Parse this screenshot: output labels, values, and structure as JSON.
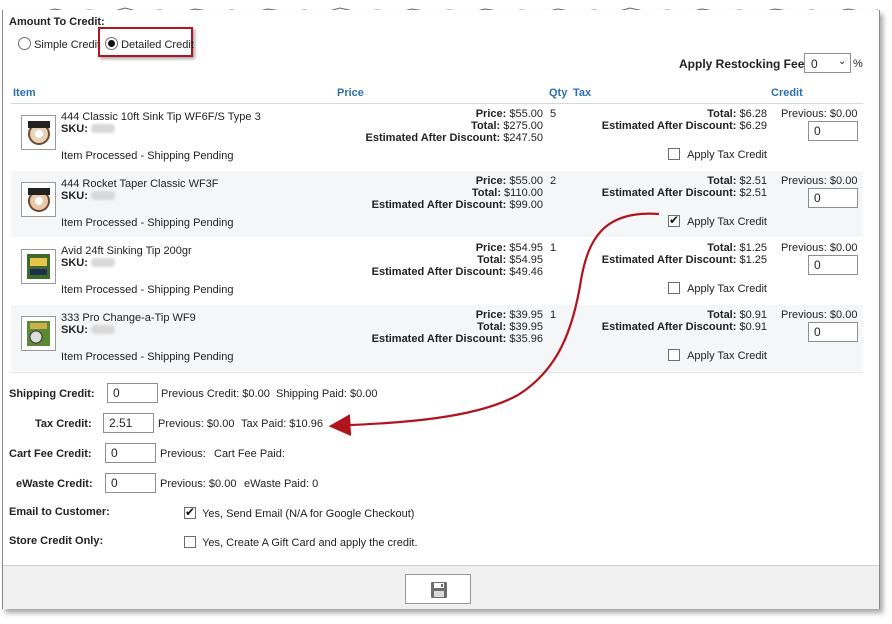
{
  "form": {
    "amount_label": "Amount To Credit:",
    "simple_credit_label": "Simple Credit",
    "detailed_credit_label": "Detailed Credit",
    "restocking_label": "Apply Restocking Fee:",
    "restocking_value": "0",
    "restocking_unit": "%"
  },
  "table": {
    "headers": {
      "item": "Item",
      "price": "Price",
      "qty": "Qty",
      "tax": "Tax",
      "credit": "Credit"
    },
    "rows": [
      {
        "name": "444 Classic 10ft Sink Tip WF6F/S Type 3",
        "sku_label": "SKU:",
        "status": "Item Processed - Shipping Pending",
        "price_label": "Price:",
        "price": "$55.00",
        "total_label": "Total:",
        "total": "$275.00",
        "est_label": "Estimated After Discount:",
        "est": "$247.50",
        "qty": "5",
        "tax_total_label": "Total:",
        "tax_total": "$6.28",
        "tax_est_label": "Estimated After Discount:",
        "tax_est": "$6.29",
        "apply_tax_label": "Apply Tax Credit",
        "apply_tax_checked": false,
        "previous": "Previous: $0.00",
        "credit": "0"
      },
      {
        "name": "444 Rocket Taper Classic WF3F",
        "sku_label": "SKU:",
        "status": "Item Processed - Shipping Pending",
        "price_label": "Price:",
        "price": "$55.00",
        "total_label": "Total:",
        "total": "$110.00",
        "est_label": "Estimated After Discount:",
        "est": "$99.00",
        "qty": "2",
        "tax_total_label": "Total:",
        "tax_total": "$2.51",
        "tax_est_label": "Estimated After Discount:",
        "tax_est": "$2.51",
        "apply_tax_label": "Apply Tax Credit",
        "apply_tax_checked": true,
        "previous": "Previous: $0.00",
        "credit": "0"
      },
      {
        "name": "Avid 24ft Sinking Tip 200gr",
        "sku_label": "SKU:",
        "status": "Item Processed - Shipping Pending",
        "price_label": "Price:",
        "price": "$54.95",
        "total_label": "Total:",
        "total": "$54.95",
        "est_label": "Estimated After Discount:",
        "est": "$49.46",
        "qty": "1",
        "tax_total_label": "Total:",
        "tax_total": "$1.25",
        "tax_est_label": "Estimated After Discount:",
        "tax_est": "$1.25",
        "apply_tax_label": "Apply Tax Credit",
        "apply_tax_checked": false,
        "previous": "Previous: $0.00",
        "credit": "0"
      },
      {
        "name": "333 Pro Change-a-Tip WF9",
        "sku_label": "SKU:",
        "status": "Item Processed - Shipping Pending",
        "price_label": "Price:",
        "price": "$39.95",
        "total_label": "Total:",
        "total": "$39.95",
        "est_label": "Estimated After Discount:",
        "est": "$35.96",
        "qty": "1",
        "tax_total_label": "Total:",
        "tax_total": "$0.91",
        "tax_est_label": "Estimated After Discount:",
        "tax_est": "$0.91",
        "apply_tax_label": "Apply Tax Credit",
        "apply_tax_checked": false,
        "previous": "Previous: $0.00",
        "credit": "0"
      }
    ]
  },
  "credits": {
    "shipping": {
      "label": "Shipping Credit:",
      "value": "0",
      "previous": "Previous Credit: $0.00",
      "paid": "Shipping Paid: $0.00"
    },
    "tax": {
      "label": "Tax Credit:",
      "value": "2.51",
      "previous": "Previous: $0.00",
      "paid": "Tax Paid: $10.96"
    },
    "cart_fee": {
      "label": "Cart Fee Credit:",
      "value": "0",
      "previous": "Previous:",
      "paid": "Cart Fee Paid:"
    },
    "ewaste": {
      "label": "eWaste Credit:",
      "value": "0",
      "previous": "Previous: $0.00",
      "paid": "eWaste Paid: 0"
    },
    "email": {
      "label": "Email to Customer:",
      "option": "Yes, Send Email (N/A for Google Checkout)",
      "checked": true
    },
    "store_credit": {
      "label": "Store Credit Only:",
      "option": "Yes, Create A Gift Card and apply the credit.",
      "checked": false
    }
  },
  "footer": {
    "save_icon": "floppy-disk-icon"
  },
  "colors": {
    "header_blue": "#2a6fb0",
    "annotation_red": "#b0141c",
    "row_alt": "#f5f6f8"
  }
}
